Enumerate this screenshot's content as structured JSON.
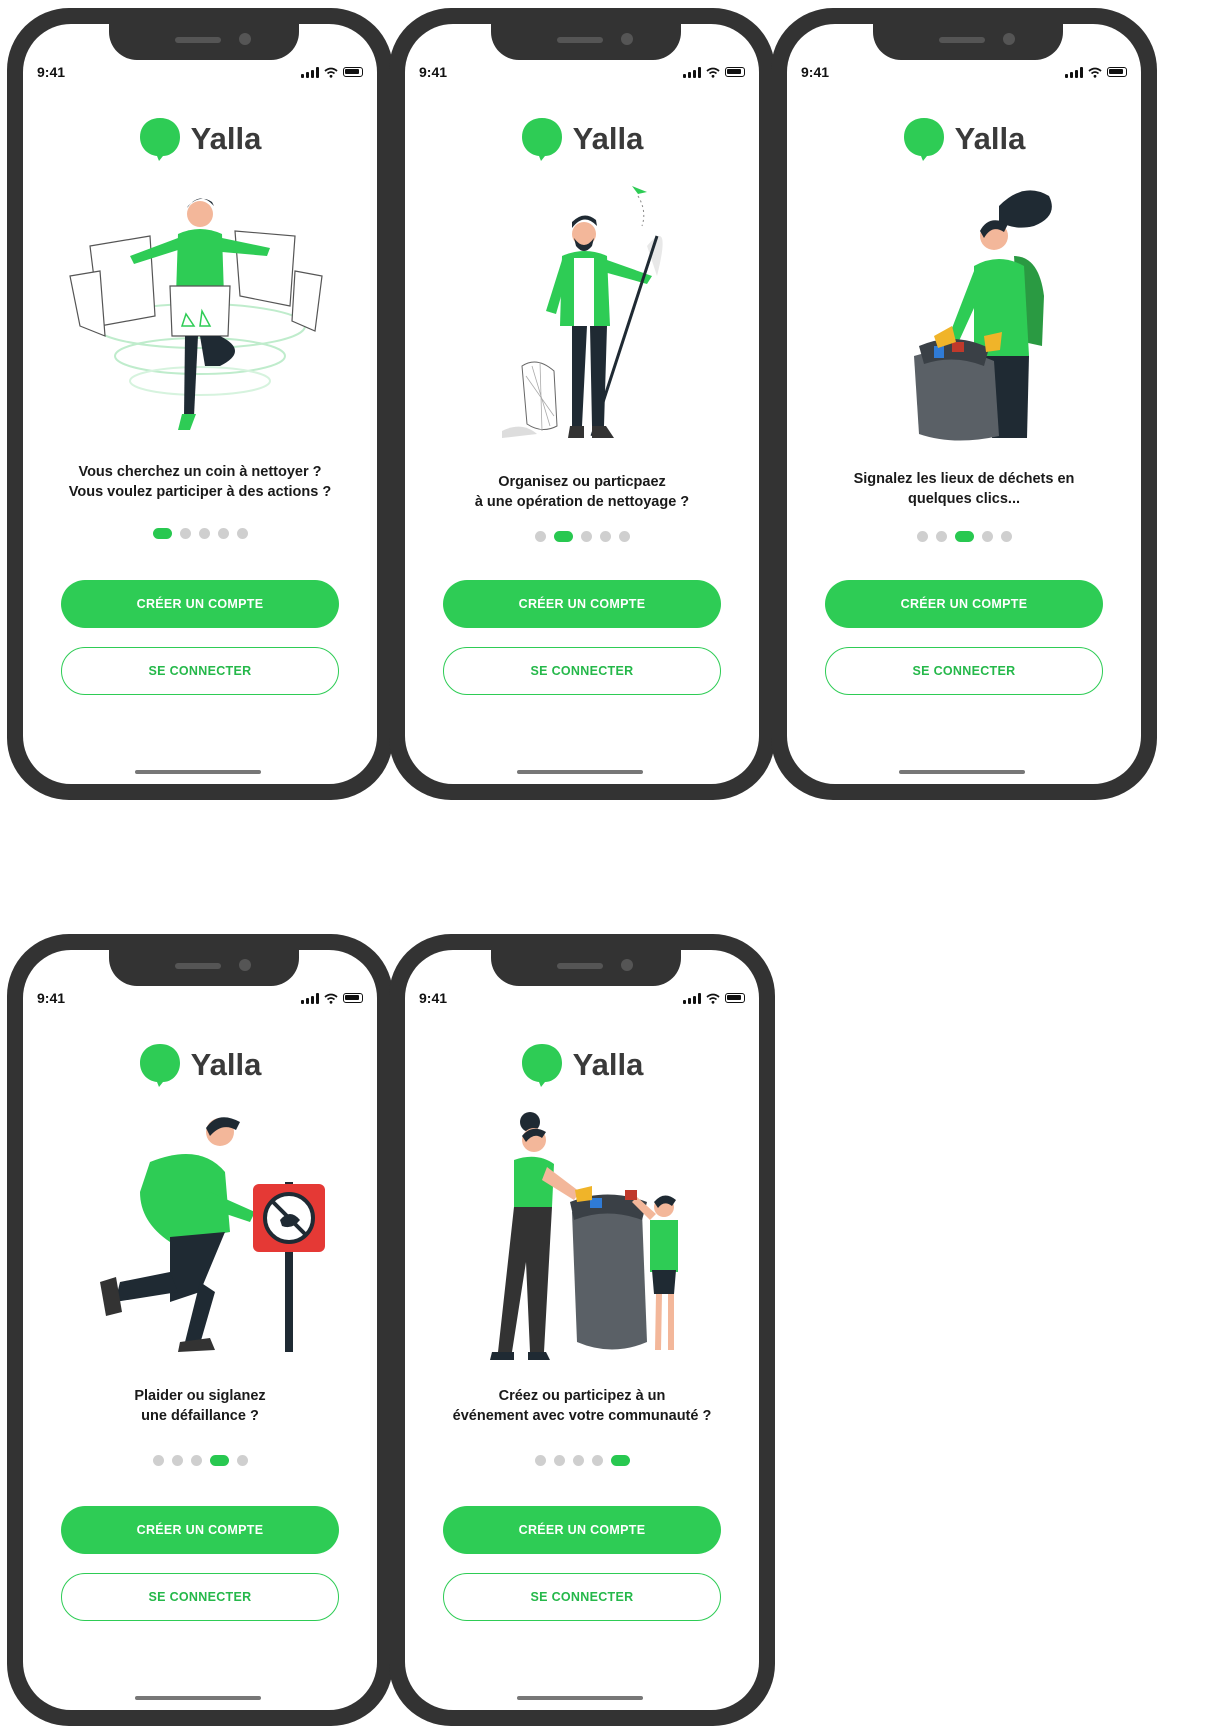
{
  "status": {
    "time": "9:41"
  },
  "brand": {
    "name": "Yalla",
    "accent": "#2ecc55"
  },
  "screens": [
    {
      "caption": [
        "Vous cherchez un coin à nettoyer ?",
        "Vous voulez participer à des actions ?"
      ],
      "active_page": 1,
      "illustration": "man-with-screens"
    },
    {
      "caption": [
        "Organisez ou particpaez",
        "à une opération de nettoyage ?"
      ],
      "active_page": 2,
      "illustration": "man-with-litter-picker"
    },
    {
      "caption": [
        "Signalez les lieux de déchets en",
        "quelques clics..."
      ],
      "active_page": 3,
      "illustration": "woman-with-trash-bag"
    },
    {
      "caption": [
        "Plaider ou siglanez",
        "une défaillance ?"
      ],
      "active_page": 4,
      "illustration": "man-with-no-littering-sign"
    },
    {
      "caption": [
        "Créez ou participez à un",
        "événement avec votre communauté ?"
      ],
      "active_page": 5,
      "illustration": "woman-and-child-with-trash-bag"
    }
  ],
  "pagination": {
    "total": 5
  },
  "buttons": {
    "create_account": "CRÉER UN COMPTE",
    "sign_in": "SE CONNECTER"
  }
}
